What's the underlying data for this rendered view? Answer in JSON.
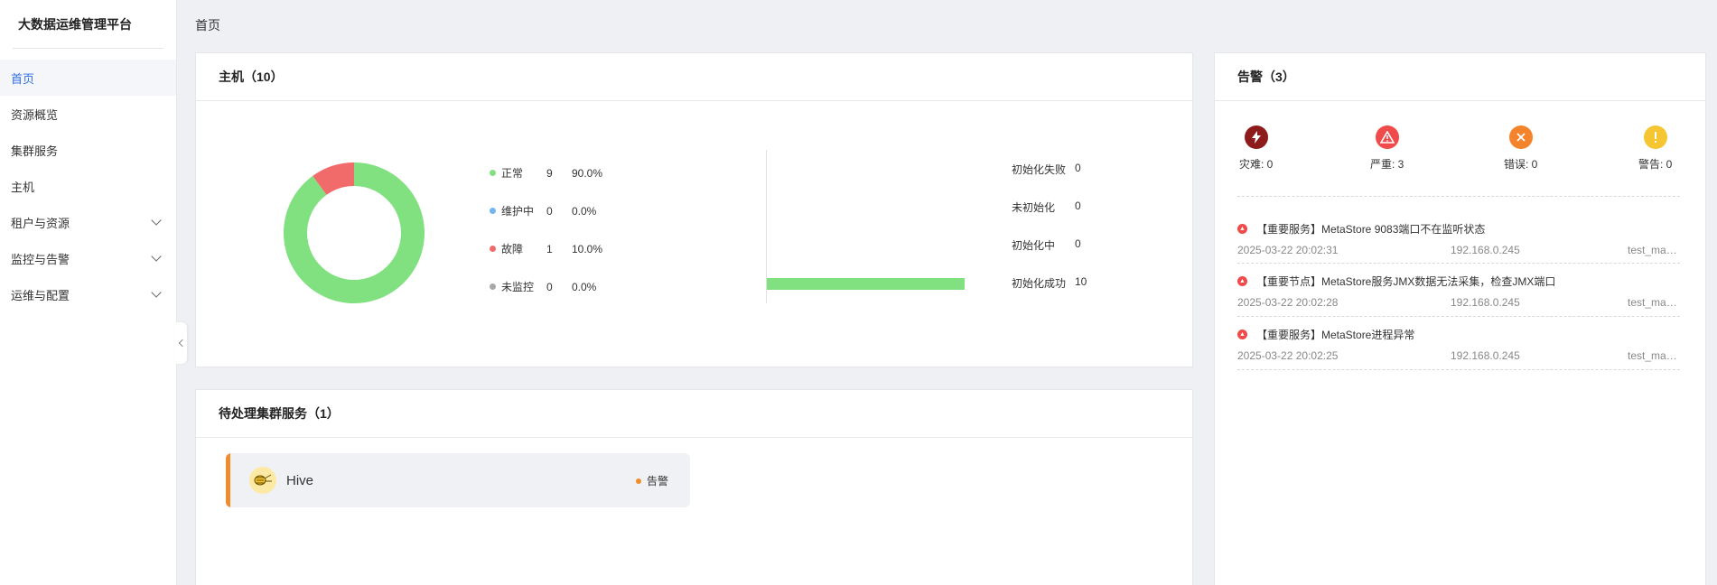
{
  "app": {
    "title": "大数据运维管理平台"
  },
  "sidebar": {
    "items": [
      {
        "label": "首页"
      },
      {
        "label": "资源概览"
      },
      {
        "label": "集群服务"
      },
      {
        "label": "主机"
      },
      {
        "label": "租户与资源"
      },
      {
        "label": "监控与告警"
      },
      {
        "label": "运维与配置"
      }
    ],
    "collapse_icon": "chevron-left-icon"
  },
  "breadcrumb": "首页",
  "hosts": {
    "title": "主机（10）",
    "donut": [
      {
        "label": "正常",
        "count": "9",
        "percent": "90.0%",
        "color": "#81e07f"
      },
      {
        "label": "维护中",
        "count": "0",
        "percent": "0.0%",
        "color": "#73b4f2"
      },
      {
        "label": "故障",
        "count": "1",
        "percent": "10.0%",
        "color": "#f26b6b"
      },
      {
        "label": "未监控",
        "count": "0",
        "percent": "0.0%",
        "color": "#a8a8a8"
      }
    ],
    "init_status": [
      {
        "label": "初始化失败",
        "value": "0"
      },
      {
        "label": "未初始化",
        "value": "0"
      },
      {
        "label": "初始化中",
        "value": "0"
      },
      {
        "label": "初始化成功",
        "value": "10"
      }
    ],
    "bar_color": "#81e07f"
  },
  "pending": {
    "title": "待处理集群服务（1）",
    "services": [
      {
        "name": "Hive",
        "status": "告警",
        "icon": "hive-logo-icon",
        "status_color": "#f18c2b"
      }
    ]
  },
  "alerts": {
    "title": "告警（3）",
    "severities": [
      {
        "label": "灾难: 0",
        "icon": "lightning-icon",
        "color": "#8e1b1b"
      },
      {
        "label": "严重: 3",
        "icon": "warning-triangle-icon",
        "color": "#f04a4a"
      },
      {
        "label": "错误: 0",
        "icon": "close-icon",
        "color": "#f5832b"
      },
      {
        "label": "警告: 0",
        "icon": "exclamation-icon",
        "color": "#f5c631"
      }
    ],
    "items": [
      {
        "title": "【重要服务】MetaStore 9083端口不在监听状态",
        "time": "2025-03-22 20:02:31",
        "ip": "192.168.0.245",
        "host": "test_master"
      },
      {
        "title": "【重要节点】MetaStore服务JMX数据无法采集，检查JMX端口",
        "time": "2025-03-22 20:02:28",
        "ip": "192.168.0.245",
        "host": "test_master"
      },
      {
        "title": "【重要服务】MetaStore进程异常",
        "time": "2025-03-22 20:02:25",
        "ip": "192.168.0.245",
        "host": "test_master"
      }
    ]
  }
}
